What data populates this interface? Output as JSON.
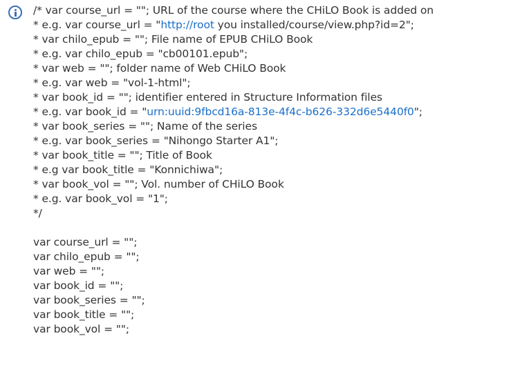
{
  "comment_lines": [
    "/* var course_url = \"\"; URL of the course where the CHiLO Book is added on",
    {
      "prefix": "* e.g. var course_url = \"",
      "link": "http://root",
      "suffix": " you installed/course/view.php?id=2\";"
    },
    "* var chilo_epub = \"\"; File name of EPUB CHiLO Book",
    "* e.g. var chilo_epub = \"cb00101.epub\";",
    "* var web = \"\"; folder name of Web CHiLO Book",
    "* e.g. var web = \"vol-1-html\";",
    "* var book_id = \"\"; identifier entered in Structure Information files",
    {
      "prefix": "* e.g. var book_id = \"",
      "link": "urn:uuid:9fbcd16a-813e-4f4c-b626-332d6e5440f0",
      "suffix": "\";"
    },
    "* var book_series = \"\"; Name of the series",
    "* e.g. var book_series = \"Nihongo Starter A1\";",
    "* var book_title = \"\"; Title of Book",
    "* e.g var book_title = \"Konnichiwa\";",
    "* var book_vol = \"\"; Vol. number of CHiLO Book",
    "* e.g. var book_vol = \"1\";",
    "*/"
  ],
  "code_lines": [
    "var course_url = \"\";",
    "var chilo_epub = \"\";",
    "var web = \"\";",
    "var book_id = \"\";",
    "var book_series = \"\";",
    "var book_title = \"\";",
    "var book_vol = \"\";"
  ],
  "colors": {
    "text": "#333333",
    "link": "#1a6fc9",
    "icon": "#3a6fb5"
  },
  "icon": "info-icon"
}
